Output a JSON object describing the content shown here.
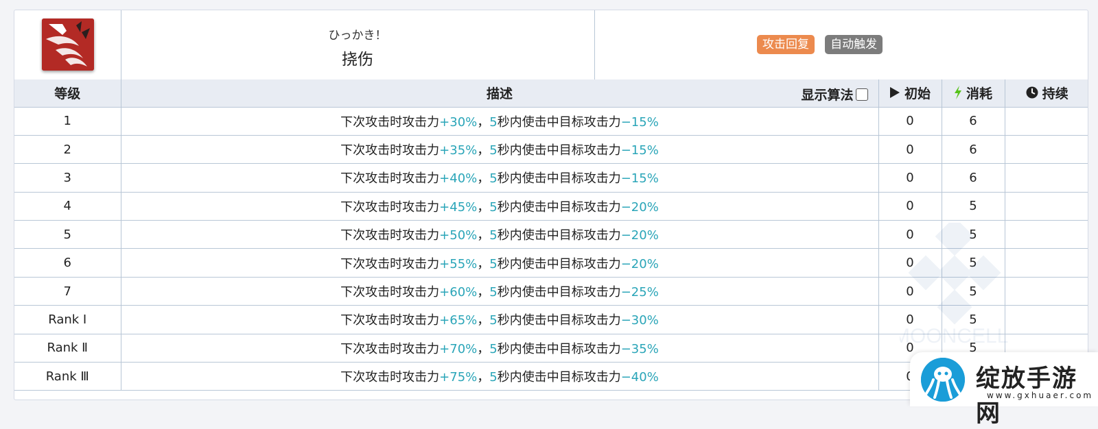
{
  "skill": {
    "name_jp": "ひっかき！",
    "name_cn": "挠伤",
    "tags": [
      "攻击回复",
      "自动触发"
    ],
    "icon": "claw-icon"
  },
  "table": {
    "headers": {
      "level": "等级",
      "description": "描述",
      "show_formula": "显示算法",
      "initial": "初始",
      "cost": "消耗",
      "duration": "持续"
    },
    "rows": [
      {
        "level": "1",
        "a": "下次攻击时攻击力",
        "b": "+30%",
        "c": "，",
        "d": "5",
        "e": "秒内使击中目标攻击力",
        "f": "−15%",
        "initial": "0",
        "cost": "6",
        "duration": ""
      },
      {
        "level": "2",
        "a": "下次攻击时攻击力",
        "b": "+35%",
        "c": "，",
        "d": "5",
        "e": "秒内使击中目标攻击力",
        "f": "−15%",
        "initial": "0",
        "cost": "6",
        "duration": ""
      },
      {
        "level": "3",
        "a": "下次攻击时攻击力",
        "b": "+40%",
        "c": "，",
        "d": "5",
        "e": "秒内使击中目标攻击力",
        "f": "−15%",
        "initial": "0",
        "cost": "6",
        "duration": ""
      },
      {
        "level": "4",
        "a": "下次攻击时攻击力",
        "b": "+45%",
        "c": "，",
        "d": "5",
        "e": "秒内使击中目标攻击力",
        "f": "−20%",
        "initial": "0",
        "cost": "5",
        "duration": ""
      },
      {
        "level": "5",
        "a": "下次攻击时攻击力",
        "b": "+50%",
        "c": "，",
        "d": "5",
        "e": "秒内使击中目标攻击力",
        "f": "−20%",
        "initial": "0",
        "cost": "5",
        "duration": ""
      },
      {
        "level": "6",
        "a": "下次攻击时攻击力",
        "b": "+55%",
        "c": "，",
        "d": "5",
        "e": "秒内使击中目标攻击力",
        "f": "−20%",
        "initial": "0",
        "cost": "5",
        "duration": ""
      },
      {
        "level": "7",
        "a": "下次攻击时攻击力",
        "b": "+60%",
        "c": "，",
        "d": "5",
        "e": "秒内使击中目标攻击力",
        "f": "−25%",
        "initial": "0",
        "cost": "5",
        "duration": ""
      },
      {
        "level": "Rank Ⅰ",
        "a": "下次攻击时攻击力",
        "b": "+65%",
        "c": "，",
        "d": "5",
        "e": "秒内使击中目标攻击力",
        "f": "−30%",
        "initial": "0",
        "cost": "5",
        "duration": ""
      },
      {
        "level": "Rank Ⅱ",
        "a": "下次攻击时攻击力",
        "b": "+70%",
        "c": "，",
        "d": "5",
        "e": "秒内使击中目标攻击力",
        "f": "−35%",
        "initial": "0",
        "cost": "5",
        "duration": ""
      },
      {
        "level": "Rank Ⅲ",
        "a": "下次攻击时攻击力",
        "b": "+75%",
        "c": "，",
        "d": "5",
        "e": "秒内使击中目标攻击力",
        "f": "−40%",
        "initial": "0",
        "cost": "",
        "duration": ""
      }
    ]
  },
  "watermark": "MOONCELL",
  "logo": {
    "text": "绽放手游网",
    "url": "www.gxhuaer.com"
  },
  "colors": {
    "highlight": "#2aa5b8",
    "tag_attack": "#ec8a4e",
    "tag_auto": "#7c7c7c",
    "cost_icon": "#56c21a",
    "header_bg": "#e8ecf3"
  }
}
